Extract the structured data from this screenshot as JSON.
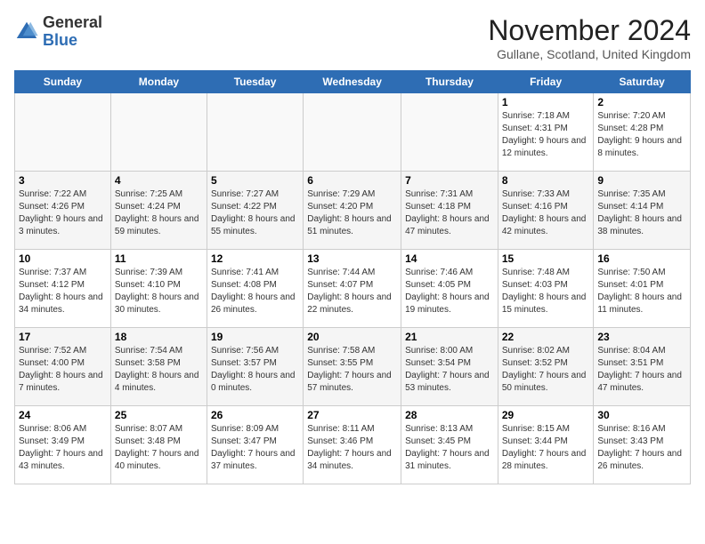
{
  "header": {
    "logo_general": "General",
    "logo_blue": "Blue",
    "month_title": "November 2024",
    "location": "Gullane, Scotland, United Kingdom"
  },
  "columns": [
    "Sunday",
    "Monday",
    "Tuesday",
    "Wednesday",
    "Thursday",
    "Friday",
    "Saturday"
  ],
  "weeks": [
    [
      {
        "num": "",
        "info": ""
      },
      {
        "num": "",
        "info": ""
      },
      {
        "num": "",
        "info": ""
      },
      {
        "num": "",
        "info": ""
      },
      {
        "num": "",
        "info": ""
      },
      {
        "num": "1",
        "info": "Sunrise: 7:18 AM\nSunset: 4:31 PM\nDaylight: 9 hours and 12 minutes."
      },
      {
        "num": "2",
        "info": "Sunrise: 7:20 AM\nSunset: 4:28 PM\nDaylight: 9 hours and 8 minutes."
      }
    ],
    [
      {
        "num": "3",
        "info": "Sunrise: 7:22 AM\nSunset: 4:26 PM\nDaylight: 9 hours and 3 minutes."
      },
      {
        "num": "4",
        "info": "Sunrise: 7:25 AM\nSunset: 4:24 PM\nDaylight: 8 hours and 59 minutes."
      },
      {
        "num": "5",
        "info": "Sunrise: 7:27 AM\nSunset: 4:22 PM\nDaylight: 8 hours and 55 minutes."
      },
      {
        "num": "6",
        "info": "Sunrise: 7:29 AM\nSunset: 4:20 PM\nDaylight: 8 hours and 51 minutes."
      },
      {
        "num": "7",
        "info": "Sunrise: 7:31 AM\nSunset: 4:18 PM\nDaylight: 8 hours and 47 minutes."
      },
      {
        "num": "8",
        "info": "Sunrise: 7:33 AM\nSunset: 4:16 PM\nDaylight: 8 hours and 42 minutes."
      },
      {
        "num": "9",
        "info": "Sunrise: 7:35 AM\nSunset: 4:14 PM\nDaylight: 8 hours and 38 minutes."
      }
    ],
    [
      {
        "num": "10",
        "info": "Sunrise: 7:37 AM\nSunset: 4:12 PM\nDaylight: 8 hours and 34 minutes."
      },
      {
        "num": "11",
        "info": "Sunrise: 7:39 AM\nSunset: 4:10 PM\nDaylight: 8 hours and 30 minutes."
      },
      {
        "num": "12",
        "info": "Sunrise: 7:41 AM\nSunset: 4:08 PM\nDaylight: 8 hours and 26 minutes."
      },
      {
        "num": "13",
        "info": "Sunrise: 7:44 AM\nSunset: 4:07 PM\nDaylight: 8 hours and 22 minutes."
      },
      {
        "num": "14",
        "info": "Sunrise: 7:46 AM\nSunset: 4:05 PM\nDaylight: 8 hours and 19 minutes."
      },
      {
        "num": "15",
        "info": "Sunrise: 7:48 AM\nSunset: 4:03 PM\nDaylight: 8 hours and 15 minutes."
      },
      {
        "num": "16",
        "info": "Sunrise: 7:50 AM\nSunset: 4:01 PM\nDaylight: 8 hours and 11 minutes."
      }
    ],
    [
      {
        "num": "17",
        "info": "Sunrise: 7:52 AM\nSunset: 4:00 PM\nDaylight: 8 hours and 7 minutes."
      },
      {
        "num": "18",
        "info": "Sunrise: 7:54 AM\nSunset: 3:58 PM\nDaylight: 8 hours and 4 minutes."
      },
      {
        "num": "19",
        "info": "Sunrise: 7:56 AM\nSunset: 3:57 PM\nDaylight: 8 hours and 0 minutes."
      },
      {
        "num": "20",
        "info": "Sunrise: 7:58 AM\nSunset: 3:55 PM\nDaylight: 7 hours and 57 minutes."
      },
      {
        "num": "21",
        "info": "Sunrise: 8:00 AM\nSunset: 3:54 PM\nDaylight: 7 hours and 53 minutes."
      },
      {
        "num": "22",
        "info": "Sunrise: 8:02 AM\nSunset: 3:52 PM\nDaylight: 7 hours and 50 minutes."
      },
      {
        "num": "23",
        "info": "Sunrise: 8:04 AM\nSunset: 3:51 PM\nDaylight: 7 hours and 47 minutes."
      }
    ],
    [
      {
        "num": "24",
        "info": "Sunrise: 8:06 AM\nSunset: 3:49 PM\nDaylight: 7 hours and 43 minutes."
      },
      {
        "num": "25",
        "info": "Sunrise: 8:07 AM\nSunset: 3:48 PM\nDaylight: 7 hours and 40 minutes."
      },
      {
        "num": "26",
        "info": "Sunrise: 8:09 AM\nSunset: 3:47 PM\nDaylight: 7 hours and 37 minutes."
      },
      {
        "num": "27",
        "info": "Sunrise: 8:11 AM\nSunset: 3:46 PM\nDaylight: 7 hours and 34 minutes."
      },
      {
        "num": "28",
        "info": "Sunrise: 8:13 AM\nSunset: 3:45 PM\nDaylight: 7 hours and 31 minutes."
      },
      {
        "num": "29",
        "info": "Sunrise: 8:15 AM\nSunset: 3:44 PM\nDaylight: 7 hours and 28 minutes."
      },
      {
        "num": "30",
        "info": "Sunrise: 8:16 AM\nSunset: 3:43 PM\nDaylight: 7 hours and 26 minutes."
      }
    ]
  ]
}
